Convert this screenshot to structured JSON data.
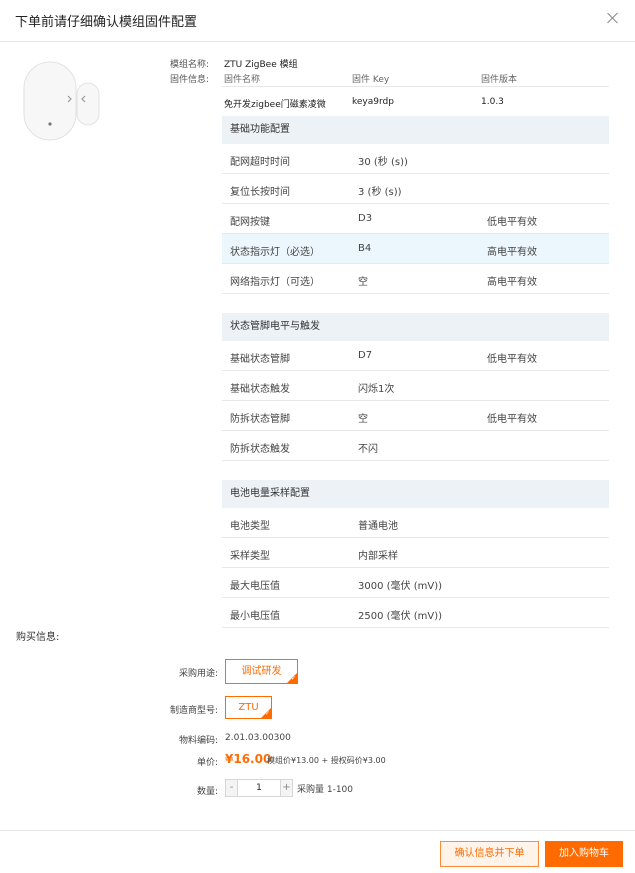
{
  "dialog": {
    "title": "下单前请仔细确认模组固件配置"
  },
  "module": {
    "name_label": "模组名称:",
    "name_value": "ZTU ZigBee 模组",
    "firmware_label": "固件信息:",
    "fw_headers": [
      "固件名称",
      "固件 Key",
      "固件版本"
    ],
    "fw_row": [
      "免开发zigbee门磁素凌微",
      "keya9rdp",
      "1.0.3"
    ]
  },
  "sections": [
    {
      "title": "基础功能配置",
      "rows": [
        {
          "name": "配网超时时间",
          "value": "30 (秒 (s))",
          "extra": ""
        },
        {
          "name": "复位长按时间",
          "value": "3 (秒 (s))",
          "extra": ""
        },
        {
          "name": "配网按键",
          "value": "D3",
          "extra": "低电平有效"
        },
        {
          "name": "状态指示灯（必选）",
          "value": "B4",
          "extra": "高电平有效"
        },
        {
          "name": "网络指示灯（可选）",
          "value": "空",
          "extra": "高电平有效"
        }
      ]
    },
    {
      "title": "状态管脚电平与触发",
      "rows": [
        {
          "name": "基础状态管脚",
          "value": "D7",
          "extra": "低电平有效"
        },
        {
          "name": "基础状态触发",
          "value": "闪烁1次",
          "extra": ""
        },
        {
          "name": "防拆状态管脚",
          "value": "空",
          "extra": "低电平有效"
        },
        {
          "name": "防拆状态触发",
          "value": "不闪",
          "extra": ""
        }
      ]
    },
    {
      "title": "电池电量采样配置",
      "rows": [
        {
          "name": "电池类型",
          "value": "普通电池",
          "extra": ""
        },
        {
          "name": "采样类型",
          "value": "内部采样",
          "extra": ""
        },
        {
          "name": "最大电压值",
          "value": "3000 (毫伏 (mV))",
          "extra": ""
        },
        {
          "name": "最小电压值",
          "value": "2500 (毫伏 (mV))",
          "extra": ""
        }
      ]
    }
  ],
  "purchase": {
    "title": "购买信息:",
    "usage_label": "采购用途:",
    "usage_value": "调试研发",
    "maker_label": "制造商型号:",
    "maker_value": "ZTU",
    "code_label": "物料编码:",
    "code_value": "2.01.03.00300",
    "price_label": "单价:",
    "price_value": "¥16.00",
    "price_note": "模组价¥13.00 + 授权码价¥3.00",
    "qty_label": "数量:",
    "qty_value": "1",
    "qty_minus": "-",
    "qty_plus": "+",
    "qty_range": "采购量 1-100"
  },
  "footer": {
    "confirm_label": "确认信息并下单",
    "cart_label": "加入购物车"
  },
  "colors": {
    "accent": "#ff6b00",
    "section_bg": "#edf2f7",
    "highlight_row": "#ecf6fd"
  }
}
